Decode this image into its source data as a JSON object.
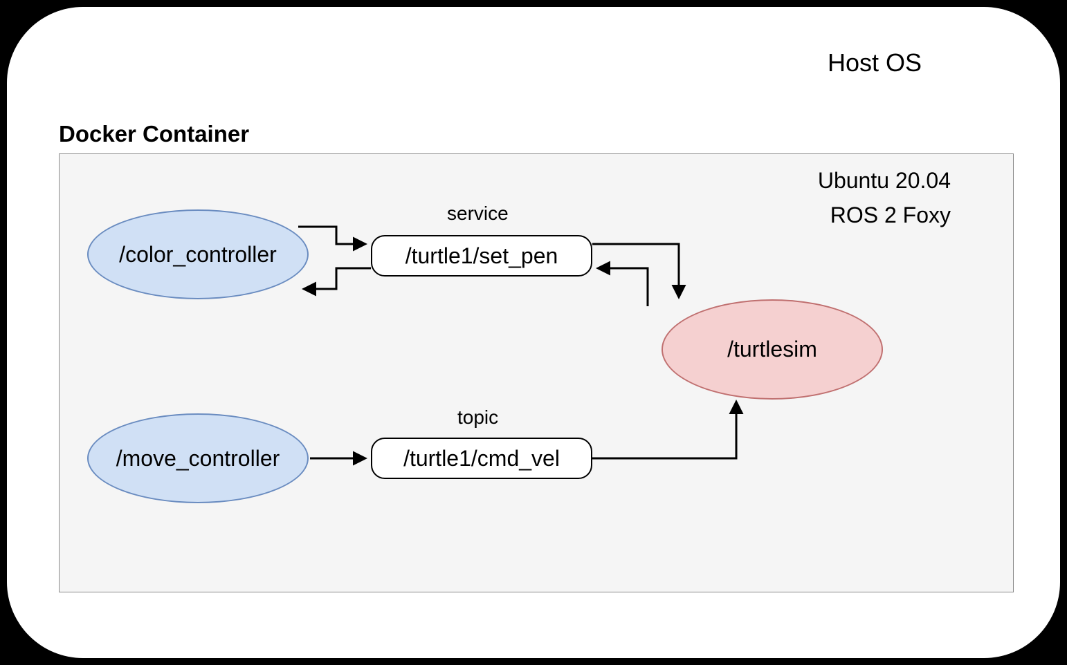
{
  "hostOs": {
    "label": "Host OS"
  },
  "docker": {
    "title": "Docker Container",
    "os": "Ubuntu 20.04",
    "ros": "ROS 2 Foxy"
  },
  "nodes": {
    "colorController": "/color_controller",
    "moveController": "/move_controller",
    "turtlesim": "/turtlesim"
  },
  "channels": {
    "setPen": "/turtle1/set_pen",
    "cmdVel": "/turtle1/cmd_vel"
  },
  "labels": {
    "service": "service",
    "topic": "topic"
  }
}
